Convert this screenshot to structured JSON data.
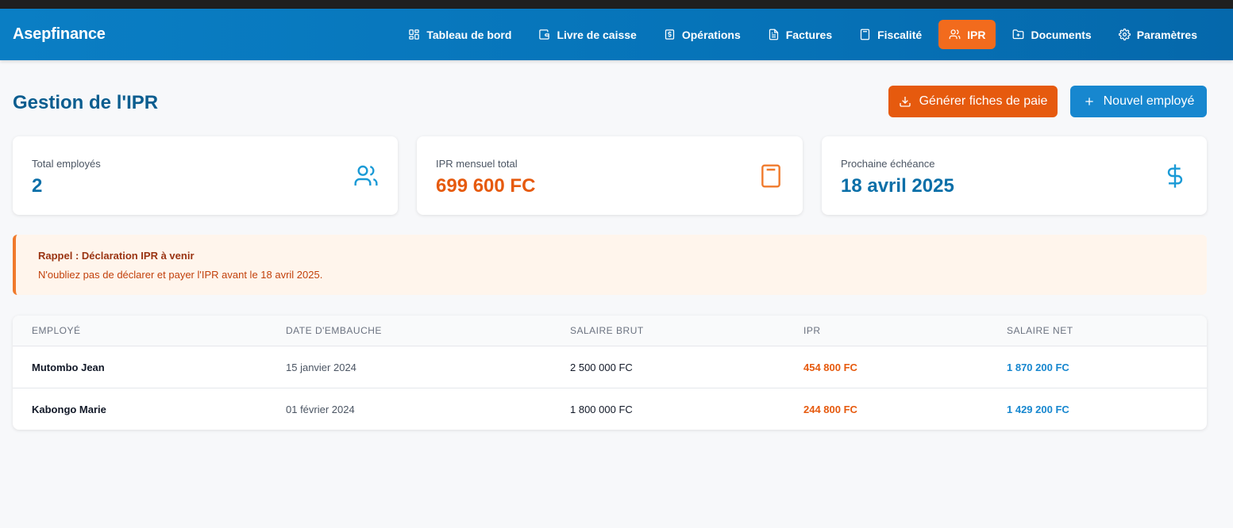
{
  "app": {
    "brand": "Asepfinance"
  },
  "nav": {
    "items": [
      {
        "label": "Tableau de bord",
        "icon": "dashboard-icon"
      },
      {
        "label": "Livre de caisse",
        "icon": "wallet-icon"
      },
      {
        "label": "Opérations",
        "icon": "dollar-doc-icon"
      },
      {
        "label": "Factures",
        "icon": "invoice-icon"
      },
      {
        "label": "Fiscalité",
        "icon": "calculator-icon"
      },
      {
        "label": "IPR",
        "icon": "users-icon",
        "active": true
      },
      {
        "label": "Documents",
        "icon": "folder-icon"
      },
      {
        "label": "Paramètres",
        "icon": "gear-icon"
      }
    ]
  },
  "page": {
    "title": "Gestion de l'IPR",
    "generate_button": "Générer fiches de paie",
    "new_employee_button": "Nouvel employé"
  },
  "stats": [
    {
      "label": "Total employés",
      "value": "2",
      "icon": "users-icon",
      "color": "#0b6fa8"
    },
    {
      "label": "IPR mensuel total",
      "value": "699 600 FC",
      "icon": "calculator-icon",
      "color": "#e65a0e"
    },
    {
      "label": "Prochaine échéance",
      "value": "18 avril 2025",
      "icon": "dollar-icon",
      "color": "#0b6fa8"
    }
  ],
  "alert": {
    "title": "Rappel : Déclaration IPR à venir",
    "text": "N'oubliez pas de déclarer et payer l'IPR avant le 18 avril 2025."
  },
  "table": {
    "headers": [
      "Employé",
      "Date d'embauche",
      "Salaire brut",
      "IPR",
      "Salaire net"
    ],
    "rows": [
      {
        "name": "Mutombo Jean",
        "hire_date": "15 janvier 2024",
        "gross": "2 500 000 FC",
        "ipr": "454 800 FC",
        "net": "1 870 200 FC"
      },
      {
        "name": "Kabongo Marie",
        "hire_date": "01 février 2024",
        "gross": "1 800 000 FC",
        "ipr": "244 800 FC",
        "net": "1 429 200 FC"
      }
    ]
  },
  "colors": {
    "primary": "#0a7ec4",
    "accent": "#f26b1d",
    "ipr": "#e65a0e",
    "net": "#1787cf"
  }
}
